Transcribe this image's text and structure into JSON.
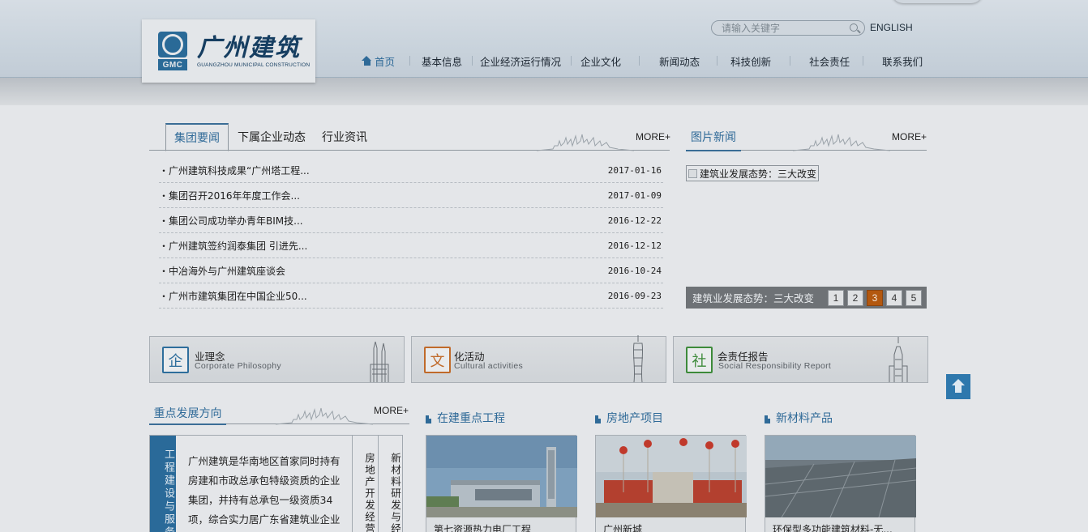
{
  "header": {
    "logo_cn": "广州建筑",
    "logo_abbr": "GMC",
    "logo_en": "GUANGZHOU MUNICIPAL CONSTRUCTION",
    "search_placeholder": "请输入关键字",
    "lang_switch": "ENGLISH"
  },
  "nav": {
    "items": [
      {
        "label": "首页",
        "active": true
      },
      {
        "label": "基本信息"
      },
      {
        "label": "企业经济运行情况"
      },
      {
        "label": "企业文化"
      },
      {
        "label": "新闻动态"
      },
      {
        "label": "科技创新"
      },
      {
        "label": "社会责任"
      },
      {
        "label": "联系我们"
      }
    ]
  },
  "news": {
    "tabs": [
      "集团要闻",
      "下属企业动态",
      "行业资讯"
    ],
    "more": "MORE+",
    "rows": [
      {
        "title": "・广州建筑科技成果“广州塔工程...",
        "date": "2017-01-16"
      },
      {
        "title": "・集团召开2016年年度工作会...",
        "date": "2017-01-09"
      },
      {
        "title": "・集团公司成功举办青年BIM技...",
        "date": "2016-12-22"
      },
      {
        "title": "・广州建筑签约润泰集团 引进先...",
        "date": "2016-12-12"
      },
      {
        "title": "・中冶海外与广州建筑座谈会",
        "date": "2016-10-24"
      },
      {
        "title": "・广州市建筑集团在中国企业50...",
        "date": "2016-09-23"
      }
    ]
  },
  "photo_news": {
    "title": "图片新闻",
    "more": "MORE+",
    "image_alt": "建筑业发展态势：三大改变",
    "caption": "建筑业发展态势：三大改变",
    "pages": [
      "1",
      "2",
      "3",
      "4",
      "5"
    ],
    "active_page": "3"
  },
  "features": [
    {
      "glyph": "企",
      "title": "业理念",
      "sub": "Corporate Philosophy",
      "color": "#2e6e9c"
    },
    {
      "glyph": "文",
      "title": "化活动",
      "sub": "Cultural activities",
      "color": "#c06a2a"
    },
    {
      "glyph": "社",
      "title": "会责任报告",
      "sub": "Social Responsibility Report",
      "color": "#3d8a3a"
    }
  ],
  "development": {
    "title": "重点发展方向",
    "more": "MORE+",
    "side_label": "工程建设与服务",
    "text": "广州建筑是华南地区首家同时持有房建和市政总承包特级资质的企业集团，并持有总承包一级资质34项，综合实力居广东省建筑业企业",
    "tab2": "房地产开发经营",
    "tab3": "新材料研发与经"
  },
  "projects": [
    {
      "heading": "在建重点工程",
      "caption": "第七资源热力电厂工程"
    },
    {
      "heading": "房地产项目",
      "caption": "广州新城"
    },
    {
      "heading": "新材料产品",
      "caption": "环保型多功能建筑材料-无..."
    }
  ]
}
